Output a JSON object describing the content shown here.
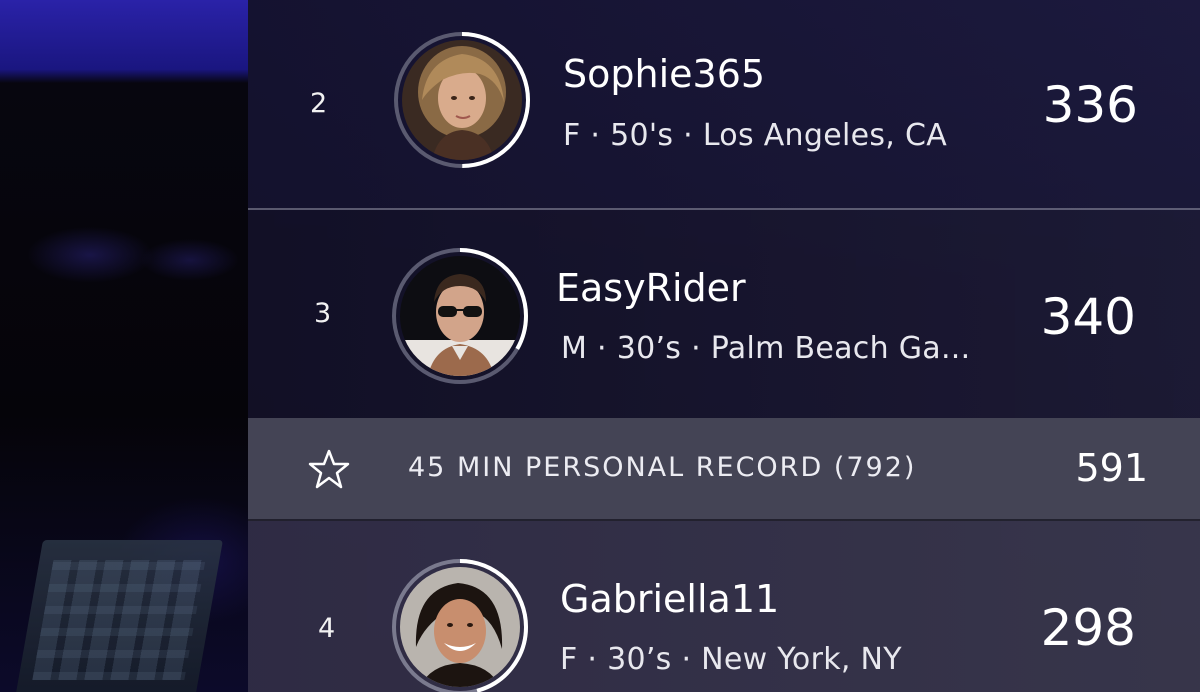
{
  "leaderboard": {
    "rows": [
      {
        "rank": "2",
        "username": "Sophie365",
        "meta": "F · 50's · Los Angeles, CA",
        "score": "336",
        "avatar_icon": "user-avatar-photo"
      },
      {
        "rank": "3",
        "username": "EasyRider",
        "meta": "M · 30’s · Palm Beach Ga...",
        "score": "340",
        "avatar_icon": "user-avatar-photo"
      },
      {
        "rank": "4",
        "username": "Gabriella11",
        "meta": "F · 30’s · New York, NY",
        "score": "298",
        "avatar_icon": "user-avatar-photo"
      }
    ],
    "personal_record": {
      "label": "45 MIN PERSONAL RECORD (792)",
      "score": "591",
      "icon": "star-outline-icon"
    }
  },
  "colors": {
    "ring_active": "#ffffff",
    "ring_track": "#5a5a70",
    "record_row": "#48485a"
  }
}
